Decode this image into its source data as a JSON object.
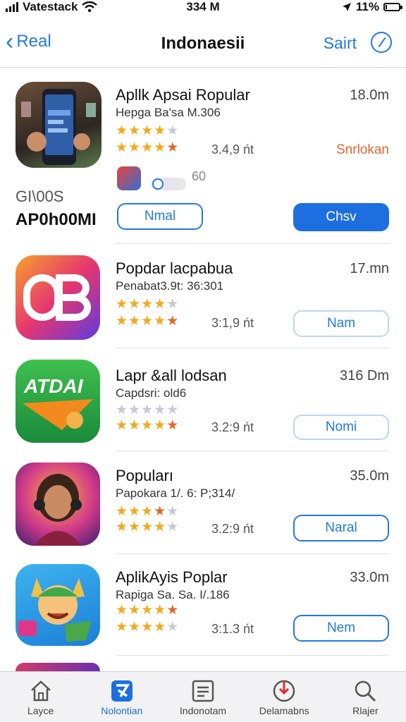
{
  "status_bar": {
    "carrier": "Vatestack",
    "time": "334 M",
    "battery": "11%",
    "battery_level": 0.11
  },
  "nav": {
    "back_label": "Real",
    "title": "Indonaesii",
    "action_label": "Sairt"
  },
  "apps": [
    {
      "name": "Apllk Apsai Ropular",
      "subtitle": "Hepga Ba'sa M.306",
      "size": "18.0m",
      "score": "3.4,9 ńt",
      "badge": "Snrlokan",
      "mini_label": "60",
      "icon_caption_1": "GI\\00S",
      "icon_caption_2": "AP0h00MI",
      "button_secondary": "Nmal",
      "button_primary": "Chsv",
      "rating_row1": 4,
      "rating_row2": 4.5
    },
    {
      "name": "Popdar lacpabua",
      "subtitle": "Penabat3.9t: 36:301",
      "size": "17.mn",
      "score": "3:1,9 ńt",
      "button": "Nam",
      "rating_row1": 4,
      "rating_row2": 4.5
    },
    {
      "name": "Lapr &all lodsan",
      "subtitle": "Capdsri: old6",
      "size": "316 Dm",
      "score": "3.2:9 ńt",
      "button": "Nomi",
      "icon_text": "ATDAI",
      "rating_row1": 0,
      "rating_row2": 4.5
    },
    {
      "name": "Popuları",
      "subtitle": "Papokara 1/. 6: P;314/",
      "size": "35.0m",
      "score": "3.2:9 ńt",
      "button": "Naral",
      "rating_row1": 3.5,
      "rating_row2": 4
    },
    {
      "name": "AplikAyis Poplar",
      "subtitle": "Rapiga Sa. Sa. I/.186",
      "size": "33.0m",
      "score": "3:1.3 ńt",
      "button": "Nem",
      "rating_row1": 4.5,
      "rating_row2": 4
    }
  ],
  "tabs": [
    {
      "label": "Layce",
      "icon": "home-icon"
    },
    {
      "label": "Nolontian",
      "icon": "apps-icon"
    },
    {
      "label": "Indonotam",
      "icon": "list-icon"
    },
    {
      "label": "Delamabns",
      "icon": "download-icon"
    },
    {
      "label": "Rlajer",
      "icon": "search-icon"
    }
  ],
  "colors": {
    "accent": "#1d6fe0",
    "star": "#f2a91c",
    "badge": "#e2672b"
  }
}
